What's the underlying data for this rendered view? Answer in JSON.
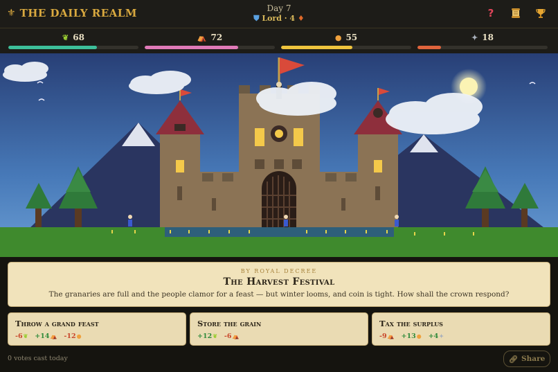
{
  "header": {
    "title": "THE DAILY REALM",
    "day": "Day 7",
    "rank": "Lord",
    "rank_sep": " · ",
    "streak": "4",
    "icons": [
      "help-icon",
      "scroll-icon",
      "trophy-icon"
    ]
  },
  "stats": [
    {
      "name": "crops",
      "icon": "wheat-icon",
      "value": "68",
      "level": 68,
      "color": "#3dbf9a"
    },
    {
      "name": "people",
      "icon": "tent-icon",
      "value": "72",
      "level": 72,
      "color": "#e07ab8"
    },
    {
      "name": "gold",
      "icon": "coin-icon",
      "value": "55",
      "level": 55,
      "color": "#efc43d"
    },
    {
      "name": "threat",
      "icon": "wolf-icon",
      "value": "18",
      "level": 18,
      "color": "#e0643c"
    }
  ],
  "event": {
    "kicker": "BY ROYAL DECREE",
    "title": "The Harvest Festival",
    "text": "The granaries are full and the people clamor for a feast — but winter looms, and coin is tight. How shall the crown respond?"
  },
  "choices": [
    {
      "label": "Throw a grand feast",
      "effects": [
        {
          "value": "-6",
          "icon": "wheat-icon",
          "sign": "neg"
        },
        {
          "value": "+14",
          "icon": "tent-icon",
          "sign": "pos"
        },
        {
          "value": "-12",
          "icon": "coin-icon",
          "sign": "neg"
        }
      ]
    },
    {
      "label": "Store the grain",
      "effects": [
        {
          "value": "+12",
          "icon": "wheat-icon",
          "sign": "pos"
        },
        {
          "value": "-6",
          "icon": "tent-icon",
          "sign": "neg"
        }
      ]
    },
    {
      "label": "Tax the surplus",
      "effects": [
        {
          "value": "-9",
          "icon": "tent-icon",
          "sign": "neg"
        },
        {
          "value": "+13",
          "icon": "coin-icon",
          "sign": "pos"
        },
        {
          "value": "+4",
          "icon": "wolf-icon",
          "sign": "pos"
        }
      ]
    }
  ],
  "footer": {
    "votes": "0 votes cast today",
    "share_label": "Share"
  }
}
